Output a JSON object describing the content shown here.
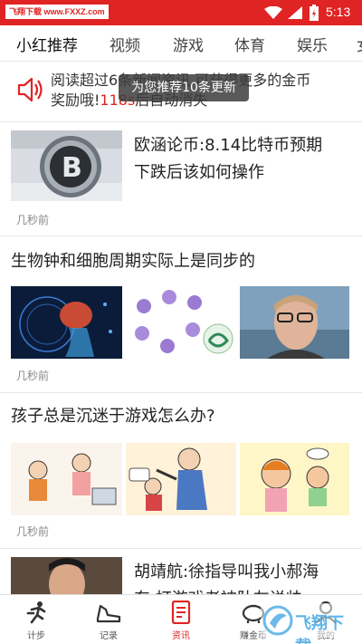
{
  "status_bar": {
    "watermark": "飞翔下载 www.FXXZ.com",
    "time": "5:13",
    "bg_color": "#e02424"
  },
  "tabs": [
    {
      "label": "小红推荐",
      "active": true
    },
    {
      "label": "视频"
    },
    {
      "label": "游戏"
    },
    {
      "label": "体育"
    },
    {
      "label": "娱乐"
    },
    {
      "label": "女"
    }
  ],
  "notice": {
    "line1": "阅读超过6条新闻资讯,可获得更多的金币",
    "line2_prefix": "奖励哦!",
    "line2_count": "118s",
    "line2_suffix": "后自动消失",
    "icon": "speaker-icon"
  },
  "toast": "为您推荐10条更新",
  "articles": [
    {
      "title_line1": "欧涵论币:8.14比特币预期",
      "title_line2": "下跌后该如何操作",
      "time": "几秒前"
    },
    {
      "title": "生物钟和细胞周期实际上是同步的",
      "time": "几秒前"
    },
    {
      "title": "孩子总是沉迷于游戏怎么办?",
      "time": "几秒前"
    },
    {
      "title_line1": "胡靖航:徐指导叫我小郝海",
      "title_line2": "东,打游戏老被队友说帅"
    }
  ],
  "bottom_nav": [
    {
      "label": "计步",
      "icon": "running-icon"
    },
    {
      "label": "记录",
      "icon": "shoe-icon"
    },
    {
      "label": "资讯",
      "icon": "news-icon",
      "active": true
    },
    {
      "label": "赚金币",
      "icon": "piggy-bank-icon"
    },
    {
      "label": "我的",
      "icon": "profile-icon"
    }
  ],
  "overlay_watermark": "飞翔下载",
  "accent_color": "#e02424"
}
